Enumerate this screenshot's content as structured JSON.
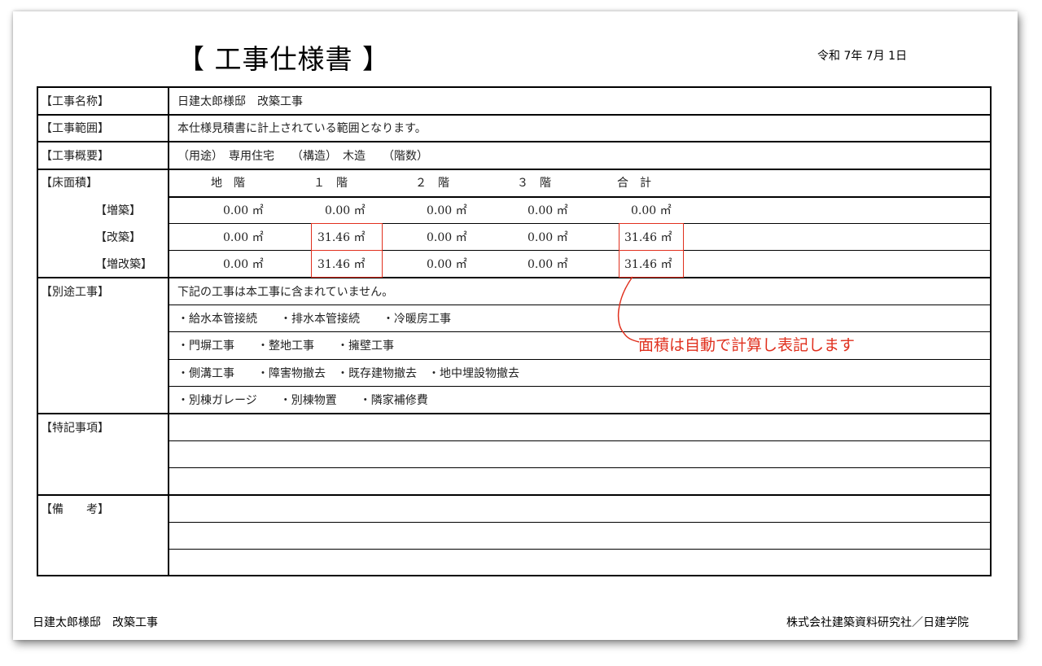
{
  "header": {
    "title": "【 工事仕様書 】",
    "date": "令和 7年 7月 1日"
  },
  "rows": {
    "name": {
      "label": "【工事名称】",
      "value": "日建太郎様邸　改築工事"
    },
    "scope": {
      "label": "【工事範囲】",
      "value": "本仕様見積書に計上されている範囲となります。"
    },
    "overview": {
      "label": "【工事概要】",
      "value": "（用途）　専用住宅　　（構造）　木造　　（階数）"
    },
    "floor_area": {
      "label": "【床面積】",
      "columns": [
        "地　階",
        "１　階",
        "２　階",
        "３　階",
        "合　計"
      ],
      "unit": "㎡",
      "rows": [
        {
          "label": "【増築】",
          "values": [
            "0.00",
            "0.00",
            "0.00",
            "0.00",
            "0.00"
          ]
        },
        {
          "label": "【改築】",
          "values": [
            "0.00",
            "31.46",
            "0.00",
            "0.00",
            "31.46"
          ]
        },
        {
          "label": "【増改築】",
          "values": [
            "0.00",
            "31.46",
            "0.00",
            "0.00",
            "31.46"
          ]
        }
      ]
    },
    "separate": {
      "label": "【別途工事】",
      "lines": [
        "下記の工事は本工事に含まれていません。",
        "・給水本管接続　　・排水本管接続　　・冷暖房工事",
        "・門塀工事　　・整地工事　　・擁壁工事",
        "・側溝工事　　・障害物撤去　・既存建物撤去　・地中埋設物撤去",
        "・別棟ガレージ　　・別棟物置　　・隣家補修費"
      ]
    },
    "special": {
      "label": "【特記事項】"
    },
    "remarks": {
      "label": "【備　　考】"
    }
  },
  "annotation": {
    "text": "面積は自動で計算し表記します",
    "color": "#e0301e"
  },
  "footer": {
    "left": "日建太郎様邸　改築工事",
    "right": "株式会社建築資料研究社／日建学院"
  }
}
